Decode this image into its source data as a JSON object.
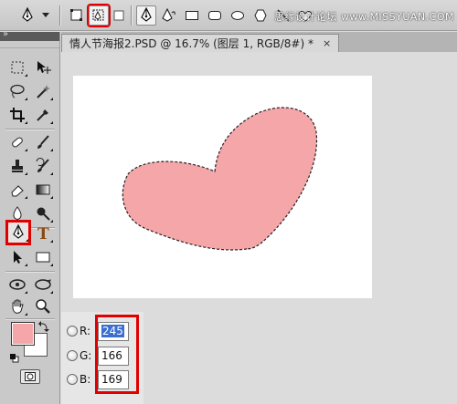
{
  "watermark": "思缘设计论坛 www.MISSYUAN.COM",
  "document": {
    "title": "情人节海报2.PSD @ 16.7% (图层 1, RGB/8#) *",
    "close_glyph": "×"
  },
  "tools_panel": {
    "collapse_glyph": "»"
  },
  "colors": {
    "foreground": "#f5a6a9",
    "background": "#ffffff",
    "heart_fill": "#f5a6a9",
    "highlight": "#e00000",
    "selection": "#3a6fd0"
  },
  "color_picker": {
    "r": {
      "label": "R:",
      "value": "245"
    },
    "g": {
      "label": "G:",
      "value": "166"
    },
    "b": {
      "label": "B:",
      "value": "169"
    }
  },
  "options_icons": [
    "pen-tool-icon",
    "shape-layers-icon",
    "paths-icon",
    "fill-pixels-icon",
    "pen-icon",
    "freeform-pen-icon",
    "rectangle-icon",
    "rounded-rectangle-icon",
    "ellipse-icon",
    "polygon-icon",
    "line-icon",
    "custom-shape-icon"
  ]
}
